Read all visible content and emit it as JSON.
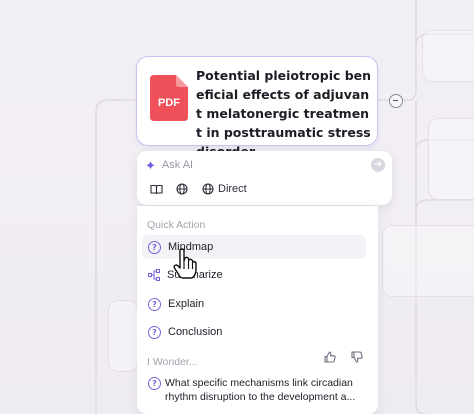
{
  "node": {
    "file_type": "PDF",
    "title": "Potential pleiotropic beneficial effects of adjuvant melatonergic treatment in posttraumatic stress disorder"
  },
  "ask": {
    "placeholder": "Ask AI",
    "mode_label": "Direct",
    "tools": [
      "book-icon",
      "globe-icon",
      "globe-icon"
    ]
  },
  "quick_action": {
    "label": "Quick Action",
    "items": [
      {
        "label": "Mindmap",
        "icon": "question-icon"
      },
      {
        "label": "Summarize",
        "icon": "mindmap-icon"
      },
      {
        "label": "Explain",
        "icon": "question-icon"
      },
      {
        "label": "Conclusion",
        "icon": "question-icon"
      }
    ]
  },
  "wonder": {
    "label": "I Wonder...",
    "question": "What specific mechanisms link circadian rhythm disruption to the development a..."
  },
  "colors": {
    "accent": "#7a63d6",
    "pdf_red": "#f0505a",
    "card_border": "#c9c2f0"
  }
}
